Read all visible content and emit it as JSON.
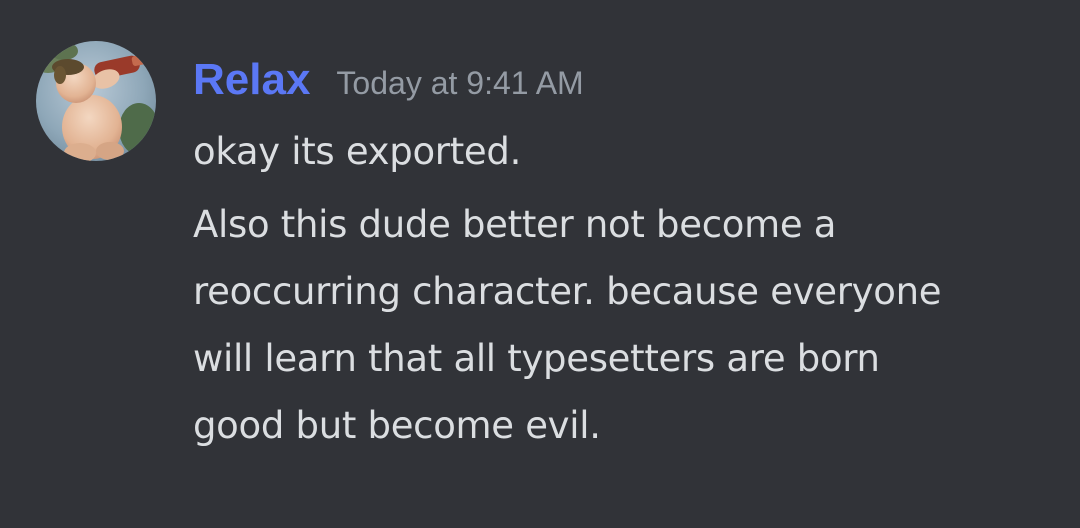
{
  "message": {
    "author": "Relax",
    "timestamp": "Today at 9:41 AM",
    "avatar_icon": "cherub-drinking-avatar",
    "colors": {
      "background": "#313338",
      "username": "#5b78f5",
      "timestamp": "#949ba4",
      "text": "#dbdee1"
    },
    "lines": [
      "okay its exported.",
      "Also this dude better not become a",
      "reoccurring character. because everyone",
      "will learn that all typesetters are born",
      "good but become evil."
    ]
  }
}
